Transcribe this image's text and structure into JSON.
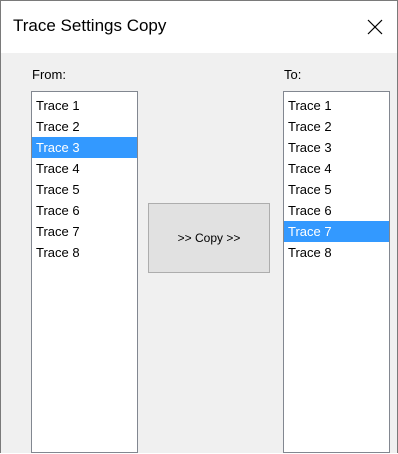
{
  "window": {
    "title": "Trace Settings Copy",
    "close_icon": "close-icon"
  },
  "from_list": {
    "label": "From:",
    "items": [
      "Trace 1",
      "Trace 2",
      "Trace 3",
      "Trace 4",
      "Trace 5",
      "Trace 6",
      "Trace 7",
      "Trace 8"
    ],
    "selected": "Trace 3"
  },
  "to_list": {
    "label": "To:",
    "items": [
      "Trace 1",
      "Trace 2",
      "Trace 3",
      "Trace 4",
      "Trace 5",
      "Trace 6",
      "Trace 7",
      "Trace 8"
    ],
    "selected": "Trace 7"
  },
  "copy_button": {
    "label": ">> Copy >>"
  },
  "colors": {
    "selection": "#3399ff",
    "dialog_bg": "#f0f0f0",
    "button_bg": "#e1e1e1"
  }
}
